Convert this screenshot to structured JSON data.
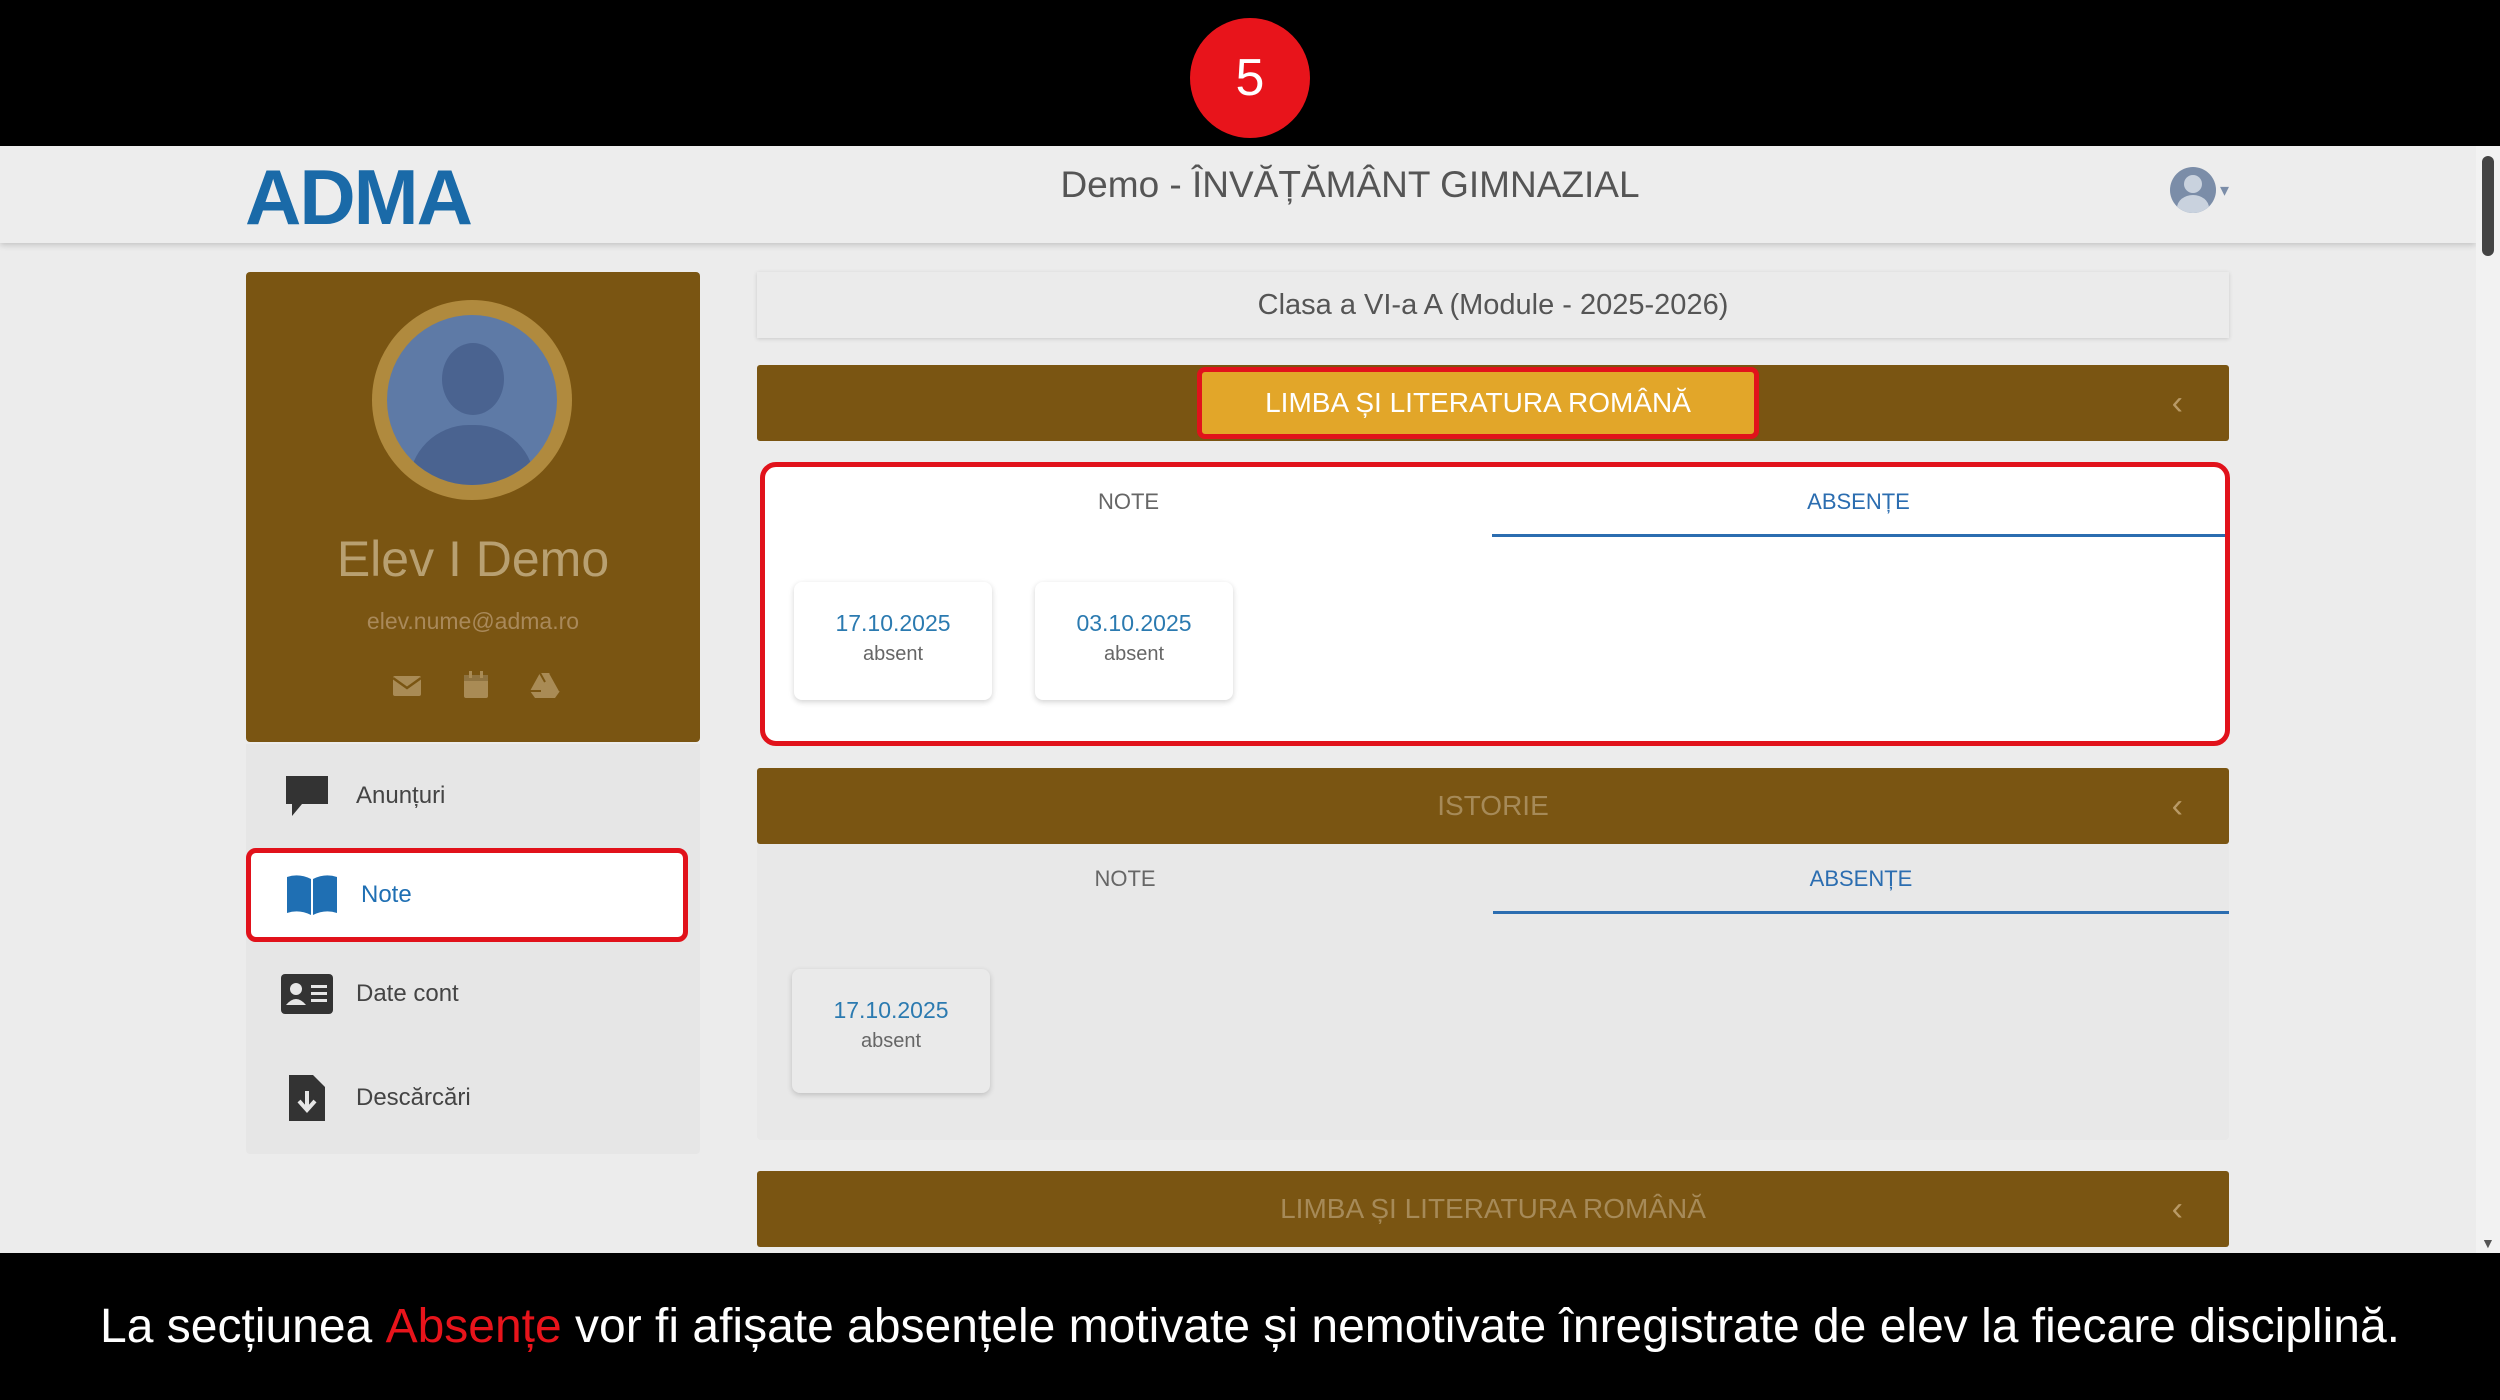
{
  "step": {
    "number": "5"
  },
  "navbar": {
    "logo": "ADMA",
    "title": "Demo - ÎNVĂȚĂMÂNT GIMNAZIAL"
  },
  "profile": {
    "name": "Elev I Demo",
    "email": "elev.nume@adma.ro",
    "icons": [
      "envelope-icon",
      "calendar-icon",
      "drive-icon"
    ]
  },
  "menu": {
    "items": [
      {
        "label": "Anunțuri",
        "icon": "chat-bubble-icon"
      },
      {
        "label": "Note",
        "icon": "open-book-icon"
      },
      {
        "label": "Date cont",
        "icon": "id-card-icon"
      },
      {
        "label": "Descărcări",
        "icon": "file-download-icon"
      }
    ],
    "active": "Note"
  },
  "class_label": "Clasa a VI-a A (Module - 2025-2026)",
  "subjects": [
    {
      "name": "LIMBA ȘI LITERATURA ROMÂNĂ",
      "tabs": [
        "NOTE",
        "ABSENȚE"
      ],
      "selected_tab": "ABSENȚE",
      "absences": [
        {
          "date": "17.10.2025",
          "status": "absent"
        },
        {
          "date": "03.10.2025",
          "status": "absent"
        }
      ]
    },
    {
      "name": "ISTORIE",
      "tabs": [
        "NOTE",
        "ABSENȚE"
      ],
      "selected_tab": "ABSENȚE",
      "absences": [
        {
          "date": "17.10.2025",
          "status": "absent"
        }
      ]
    },
    {
      "name": "LIMBA ȘI LITERATURA ROMÂNĂ"
    }
  ],
  "caption": {
    "before": "La secțiunea ",
    "highlight": "Absențe",
    "after": " vor fi afișate absențele motivate și nemotivate înregistrate de elev la fiecare disciplină."
  },
  "colors": {
    "highlight_red": "#e1121b",
    "subject_bar": "#7a5512",
    "subject_active": "#e2a629",
    "link_blue": "#2b6db0"
  }
}
